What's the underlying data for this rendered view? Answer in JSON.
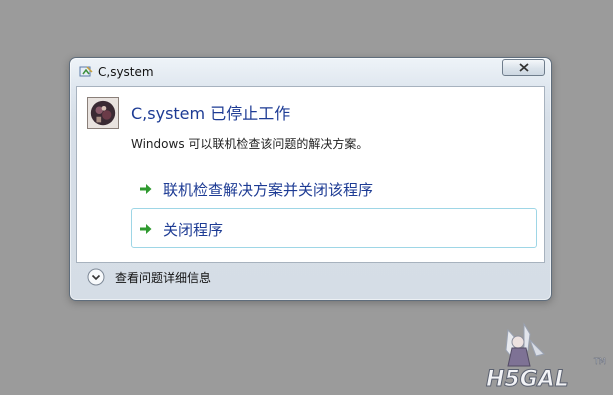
{
  "dialog": {
    "title": "C,system",
    "heading": "C,system 已停止工作",
    "description": "Windows 可以联机检查该问题的解决方案。",
    "commands": [
      {
        "label": "联机检查解决方案并关闭该程序"
      },
      {
        "label": "关闭程序"
      }
    ],
    "details_label": "查看问题详细信息"
  },
  "watermark": {
    "text": "H5GAL",
    "tm": "TM"
  },
  "colors": {
    "desktop": "#9b9b9b",
    "link_blue": "#1d3b94",
    "arrow_green": "#2f9a2f",
    "selection_border": "#9ed6e6"
  }
}
